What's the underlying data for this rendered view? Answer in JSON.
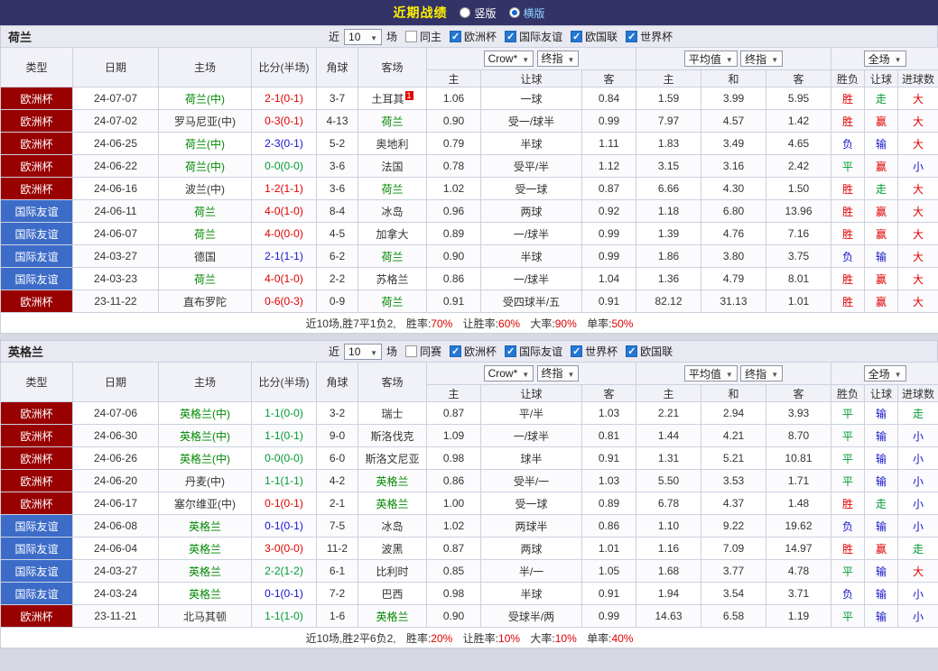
{
  "colors": {
    "euro": "#990000",
    "friendly": "#3d6cc8",
    "team_green": "#008800",
    "red": "#e00000",
    "green": "#009933",
    "blue": "#1414cc",
    "topbar_bg": "#333367",
    "title_yellow": "#ffef00",
    "checkbox_blue": "#2478d2"
  },
  "topbar": {
    "title": "近期战绩",
    "radio_vertical": "竖版",
    "radio_horizontal": "横版"
  },
  "headers": {
    "type": "类型",
    "date": "日期",
    "home": "主场",
    "score": "比分(半场)",
    "corner": "角球",
    "away": "客场",
    "o_home": "主",
    "o_handicap": "让球",
    "o_away": "客",
    "a_home": "主",
    "a_draw": "和",
    "a_away": "客",
    "r_wdl": "胜负",
    "r_handicap": "让球",
    "r_goals": "进球数"
  },
  "selects": {
    "bookmaker": "Crow*",
    "final1": "终指",
    "average": "平均值",
    "final2": "终指",
    "scope": "全场"
  },
  "sections": [
    {
      "team": "荷兰",
      "filter": {
        "recent_label": "近",
        "count": "10",
        "games_label": "场",
        "same_label": "同主",
        "leagues": [
          "欧洲杯",
          "国际友谊",
          "欧国联",
          "世界杯"
        ]
      },
      "summary": {
        "prefix": "近10场,胜7平1负2,",
        "stats": [
          {
            "label": "胜率:",
            "value": "70%"
          },
          {
            "label": "让胜率:",
            "value": "60%"
          },
          {
            "label": "大率:",
            "value": "90%"
          },
          {
            "label": "单率:",
            "value": "50%"
          }
        ]
      },
      "rows": [
        {
          "type": "欧洲杯",
          "type_key": "euro",
          "date": "24-07-07",
          "home": "荷兰(中)",
          "home_focus": true,
          "score": "2-1(0-1)",
          "score_color": "red",
          "corner": "3-7",
          "away": "土耳其",
          "away_focus": false,
          "away_badge": "1",
          "odds1": {
            "home": "1.06",
            "line": "一球",
            "away": "0.84"
          },
          "odds2": {
            "home": "1.59",
            "draw": "3.99",
            "away": "5.95"
          },
          "results": {
            "wdl": "胜",
            "wdl_color": "red",
            "handicap": "走",
            "handicap_color": "green",
            "goals": "大",
            "goals_color": "red"
          }
        },
        {
          "type": "欧洲杯",
          "type_key": "euro",
          "date": "24-07-02",
          "home": "罗马尼亚(中)",
          "home_focus": false,
          "score": "0-3(0-1)",
          "score_color": "red",
          "corner": "4-13",
          "away": "荷兰",
          "away_focus": true,
          "odds1": {
            "home": "0.90",
            "line": "受一/球半",
            "away": "0.99"
          },
          "odds2": {
            "home": "7.97",
            "draw": "4.57",
            "away": "1.42"
          },
          "results": {
            "wdl": "胜",
            "wdl_color": "red",
            "handicap": "赢",
            "handicap_color": "red",
            "goals": "大",
            "goals_color": "red"
          }
        },
        {
          "type": "欧洲杯",
          "type_key": "euro",
          "date": "24-06-25",
          "home": "荷兰(中)",
          "home_focus": true,
          "score": "2-3(0-1)",
          "score_color": "blue",
          "corner": "5-2",
          "away": "奥地利",
          "away_focus": false,
          "odds1": {
            "home": "0.79",
            "line": "半球",
            "away": "1.11"
          },
          "odds2": {
            "home": "1.83",
            "draw": "3.49",
            "away": "4.65"
          },
          "results": {
            "wdl": "负",
            "wdl_color": "blue",
            "handicap": "输",
            "handicap_color": "blue",
            "goals": "大",
            "goals_color": "red"
          }
        },
        {
          "type": "欧洲杯",
          "type_key": "euro",
          "date": "24-06-22",
          "home": "荷兰(中)",
          "home_focus": true,
          "score": "0-0(0-0)",
          "score_color": "green",
          "corner": "3-6",
          "away": "法国",
          "away_focus": false,
          "odds1": {
            "home": "0.78",
            "line": "受平/半",
            "away": "1.12"
          },
          "odds2": {
            "home": "3.15",
            "draw": "3.16",
            "away": "2.42"
          },
          "results": {
            "wdl": "平",
            "wdl_color": "green",
            "handicap": "赢",
            "handicap_color": "red",
            "goals": "小",
            "goals_color": "blue"
          }
        },
        {
          "type": "欧洲杯",
          "type_key": "euro",
          "date": "24-06-16",
          "home": "波兰(中)",
          "home_focus": false,
          "score": "1-2(1-1)",
          "score_color": "red",
          "corner": "3-6",
          "away": "荷兰",
          "away_focus": true,
          "odds1": {
            "home": "1.02",
            "line": "受一球",
            "away": "0.87"
          },
          "odds2": {
            "home": "6.66",
            "draw": "4.30",
            "away": "1.50"
          },
          "results": {
            "wdl": "胜",
            "wdl_color": "red",
            "handicap": "走",
            "handicap_color": "green",
            "goals": "大",
            "goals_color": "red"
          }
        },
        {
          "type": "国际友谊",
          "type_key": "friendly",
          "date": "24-06-11",
          "home": "荷兰",
          "home_focus": true,
          "score": "4-0(1-0)",
          "score_color": "red",
          "corner": "8-4",
          "away": "冰岛",
          "away_focus": false,
          "odds1": {
            "home": "0.96",
            "line": "两球",
            "away": "0.92"
          },
          "odds2": {
            "home": "1.18",
            "draw": "6.80",
            "away": "13.96"
          },
          "results": {
            "wdl": "胜",
            "wdl_color": "red",
            "handicap": "赢",
            "handicap_color": "red",
            "goals": "大",
            "goals_color": "red"
          }
        },
        {
          "type": "国际友谊",
          "type_key": "friendly",
          "date": "24-06-07",
          "home": "荷兰",
          "home_focus": true,
          "score": "4-0(0-0)",
          "score_color": "red",
          "corner": "4-5",
          "away": "加拿大",
          "away_focus": false,
          "odds1": {
            "home": "0.89",
            "line": "一/球半",
            "away": "0.99"
          },
          "odds2": {
            "home": "1.39",
            "draw": "4.76",
            "away": "7.16"
          },
          "results": {
            "wdl": "胜",
            "wdl_color": "red",
            "handicap": "赢",
            "handicap_color": "red",
            "goals": "大",
            "goals_color": "red"
          }
        },
        {
          "type": "国际友谊",
          "type_key": "friendly",
          "date": "24-03-27",
          "home": "德国",
          "home_focus": false,
          "score": "2-1(1-1)",
          "score_color": "blue",
          "corner": "6-2",
          "away": "荷兰",
          "away_focus": true,
          "odds1": {
            "home": "0.90",
            "line": "半球",
            "away": "0.99"
          },
          "odds2": {
            "home": "1.86",
            "draw": "3.80",
            "away": "3.75"
          },
          "results": {
            "wdl": "负",
            "wdl_color": "blue",
            "handicap": "输",
            "handicap_color": "blue",
            "goals": "大",
            "goals_color": "red"
          }
        },
        {
          "type": "国际友谊",
          "type_key": "friendly",
          "date": "24-03-23",
          "home": "荷兰",
          "home_focus": true,
          "score": "4-0(1-0)",
          "score_color": "red",
          "corner": "2-2",
          "away": "苏格兰",
          "away_focus": false,
          "odds1": {
            "home": "0.86",
            "line": "一/球半",
            "away": "1.04"
          },
          "odds2": {
            "home": "1.36",
            "draw": "4.79",
            "away": "8.01"
          },
          "results": {
            "wdl": "胜",
            "wdl_color": "red",
            "handicap": "赢",
            "handicap_color": "red",
            "goals": "大",
            "goals_color": "red"
          }
        },
        {
          "type": "欧洲杯",
          "type_key": "euro",
          "date": "23-11-22",
          "home": "直布罗陀",
          "home_focus": false,
          "score": "0-6(0-3)",
          "score_color": "red",
          "corner": "0-9",
          "away": "荷兰",
          "away_focus": true,
          "odds1": {
            "home": "0.91",
            "line": "受四球半/五",
            "away": "0.91"
          },
          "odds2": {
            "home": "82.12",
            "draw": "31.13",
            "away": "1.01"
          },
          "results": {
            "wdl": "胜",
            "wdl_color": "red",
            "handicap": "赢",
            "handicap_color": "red",
            "goals": "大",
            "goals_color": "red"
          }
        }
      ]
    },
    {
      "team": "英格兰",
      "filter": {
        "recent_label": "近",
        "count": "10",
        "games_label": "场",
        "same_label": "同赛",
        "leagues": [
          "欧洲杯",
          "国际友谊",
          "世界杯",
          "欧国联"
        ]
      },
      "summary": {
        "prefix": "近10场,胜2平6负2,",
        "stats": [
          {
            "label": "胜率:",
            "value": "20%"
          },
          {
            "label": "让胜率:",
            "value": "10%"
          },
          {
            "label": "大率:",
            "value": "10%"
          },
          {
            "label": "单率:",
            "value": "40%"
          }
        ]
      },
      "rows": [
        {
          "type": "欧洲杯",
          "type_key": "euro",
          "date": "24-07-06",
          "home": "英格兰(中)",
          "home_focus": true,
          "score": "1-1(0-0)",
          "score_color": "green",
          "corner": "3-2",
          "away": "瑞士",
          "away_focus": false,
          "odds1": {
            "home": "0.87",
            "line": "平/半",
            "away": "1.03"
          },
          "odds2": {
            "home": "2.21",
            "draw": "2.94",
            "away": "3.93"
          },
          "results": {
            "wdl": "平",
            "wdl_color": "green",
            "handicap": "输",
            "handicap_color": "blue",
            "goals": "走",
            "goals_color": "green"
          }
        },
        {
          "type": "欧洲杯",
          "type_key": "euro",
          "date": "24-06-30",
          "home": "英格兰(中)",
          "home_focus": true,
          "score": "1-1(0-1)",
          "score_color": "green",
          "corner": "9-0",
          "away": "斯洛伐克",
          "away_focus": false,
          "odds1": {
            "home": "1.09",
            "line": "一/球半",
            "away": "0.81"
          },
          "odds2": {
            "home": "1.44",
            "draw": "4.21",
            "away": "8.70"
          },
          "results": {
            "wdl": "平",
            "wdl_color": "green",
            "handicap": "输",
            "handicap_color": "blue",
            "goals": "小",
            "goals_color": "blue"
          }
        },
        {
          "type": "欧洲杯",
          "type_key": "euro",
          "date": "24-06-26",
          "home": "英格兰(中)",
          "home_focus": true,
          "score": "0-0(0-0)",
          "score_color": "green",
          "corner": "6-0",
          "away": "斯洛文尼亚",
          "away_focus": false,
          "odds1": {
            "home": "0.98",
            "line": "球半",
            "away": "0.91"
          },
          "odds2": {
            "home": "1.31",
            "draw": "5.21",
            "away": "10.81"
          },
          "results": {
            "wdl": "平",
            "wdl_color": "green",
            "handicap": "输",
            "handicap_color": "blue",
            "goals": "小",
            "goals_color": "blue"
          }
        },
        {
          "type": "欧洲杯",
          "type_key": "euro",
          "date": "24-06-20",
          "home": "丹麦(中)",
          "home_focus": false,
          "score": "1-1(1-1)",
          "score_color": "green",
          "corner": "4-2",
          "away": "英格兰",
          "away_focus": true,
          "odds1": {
            "home": "0.86",
            "line": "受半/一",
            "away": "1.03"
          },
          "odds2": {
            "home": "5.50",
            "draw": "3.53",
            "away": "1.71"
          },
          "results": {
            "wdl": "平",
            "wdl_color": "green",
            "handicap": "输",
            "handicap_color": "blue",
            "goals": "小",
            "goals_color": "blue"
          }
        },
        {
          "type": "欧洲杯",
          "type_key": "euro",
          "date": "24-06-17",
          "home": "塞尔维亚(中)",
          "home_focus": false,
          "score": "0-1(0-1)",
          "score_color": "red",
          "corner": "2-1",
          "away": "英格兰",
          "away_focus": true,
          "odds1": {
            "home": "1.00",
            "line": "受一球",
            "away": "0.89"
          },
          "odds2": {
            "home": "6.78",
            "draw": "4.37",
            "away": "1.48"
          },
          "results": {
            "wdl": "胜",
            "wdl_color": "red",
            "handicap": "走",
            "handicap_color": "green",
            "goals": "小",
            "goals_color": "blue"
          }
        },
        {
          "type": "国际友谊",
          "type_key": "friendly",
          "date": "24-06-08",
          "home": "英格兰",
          "home_focus": true,
          "score": "0-1(0-1)",
          "score_color": "blue",
          "corner": "7-5",
          "away": "冰岛",
          "away_focus": false,
          "odds1": {
            "home": "1.02",
            "line": "两球半",
            "away": "0.86"
          },
          "odds2": {
            "home": "1.10",
            "draw": "9.22",
            "away": "19.62"
          },
          "results": {
            "wdl": "负",
            "wdl_color": "blue",
            "handicap": "输",
            "handicap_color": "blue",
            "goals": "小",
            "goals_color": "blue"
          }
        },
        {
          "type": "国际友谊",
          "type_key": "friendly",
          "date": "24-06-04",
          "home": "英格兰",
          "home_focus": true,
          "score": "3-0(0-0)",
          "score_color": "red",
          "corner": "11-2",
          "away": "波黑",
          "away_focus": false,
          "odds1": {
            "home": "0.87",
            "line": "两球",
            "away": "1.01"
          },
          "odds2": {
            "home": "1.16",
            "draw": "7.09",
            "away": "14.97"
          },
          "results": {
            "wdl": "胜",
            "wdl_color": "red",
            "handicap": "赢",
            "handicap_color": "red",
            "goals": "走",
            "goals_color": "green"
          }
        },
        {
          "type": "国际友谊",
          "type_key": "friendly",
          "date": "24-03-27",
          "home": "英格兰",
          "home_focus": true,
          "score": "2-2(1-2)",
          "score_color": "green",
          "corner": "6-1",
          "away": "比利时",
          "away_focus": false,
          "odds1": {
            "home": "0.85",
            "line": "半/一",
            "away": "1.05"
          },
          "odds2": {
            "home": "1.68",
            "draw": "3.77",
            "away": "4.78"
          },
          "results": {
            "wdl": "平",
            "wdl_color": "green",
            "handicap": "输",
            "handicap_color": "blue",
            "goals": "大",
            "goals_color": "red"
          }
        },
        {
          "type": "国际友谊",
          "type_key": "friendly",
          "date": "24-03-24",
          "home": "英格兰",
          "home_focus": true,
          "score": "0-1(0-1)",
          "score_color": "blue",
          "corner": "7-2",
          "away": "巴西",
          "away_focus": false,
          "odds1": {
            "home": "0.98",
            "line": "半球",
            "away": "0.91"
          },
          "odds2": {
            "home": "1.94",
            "draw": "3.54",
            "away": "3.71"
          },
          "results": {
            "wdl": "负",
            "wdl_color": "blue",
            "handicap": "输",
            "handicap_color": "blue",
            "goals": "小",
            "goals_color": "blue"
          }
        },
        {
          "type": "欧洲杯",
          "type_key": "euro",
          "date": "23-11-21",
          "home": "北马其顿",
          "home_focus": false,
          "score": "1-1(1-0)",
          "score_color": "green",
          "corner": "1-6",
          "away": "英格兰",
          "away_focus": true,
          "odds1": {
            "home": "0.90",
            "line": "受球半/两",
            "away": "0.99"
          },
          "odds2": {
            "home": "14.63",
            "draw": "6.58",
            "away": "1.19"
          },
          "results": {
            "wdl": "平",
            "wdl_color": "green",
            "handicap": "输",
            "handicap_color": "blue",
            "goals": "小",
            "goals_color": "blue"
          }
        }
      ]
    }
  ]
}
